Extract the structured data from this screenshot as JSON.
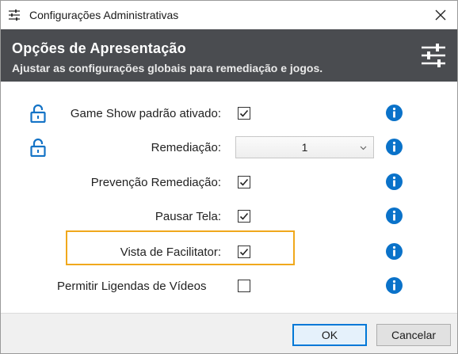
{
  "window": {
    "title": "Configurações Administrativas",
    "icon": "sliders-icon",
    "close_icon": "close-icon"
  },
  "header": {
    "title": "Opções de Apresentação",
    "subtitle": "Ajustar as configurações globais para remediação e jogos.",
    "icon": "sliders-icon",
    "background_color": "#4a4c50"
  },
  "settings": [
    {
      "label": "Game Show padrão ativado:",
      "control": "checkbox",
      "checked": true,
      "locked": true,
      "info_icon": "info-icon"
    },
    {
      "label": "Remediação:",
      "control": "select",
      "selected_value": "1",
      "locked": true,
      "info_icon": "info-icon"
    },
    {
      "label": "Prevenção Remediação:",
      "control": "checkbox",
      "checked": true,
      "locked": false,
      "info_icon": "info-icon"
    },
    {
      "label": "Pausar Tela:",
      "control": "checkbox",
      "checked": true,
      "locked": false,
      "info_icon": "info-icon"
    },
    {
      "label": "Vista de Facilitator:",
      "control": "checkbox",
      "checked": true,
      "locked": false,
      "highlighted": true,
      "info_icon": "info-icon"
    },
    {
      "label": "Permitir Ligendas de Vídeos",
      "control": "checkbox",
      "checked": false,
      "locked": false,
      "info_icon": "info-icon"
    }
  ],
  "footer": {
    "ok_label": "OK",
    "cancel_label": "Cancelar"
  },
  "colors": {
    "accent_blue": "#0a72c9",
    "highlight_orange": "#f0a81c",
    "lock_blue": "#1473c6"
  }
}
